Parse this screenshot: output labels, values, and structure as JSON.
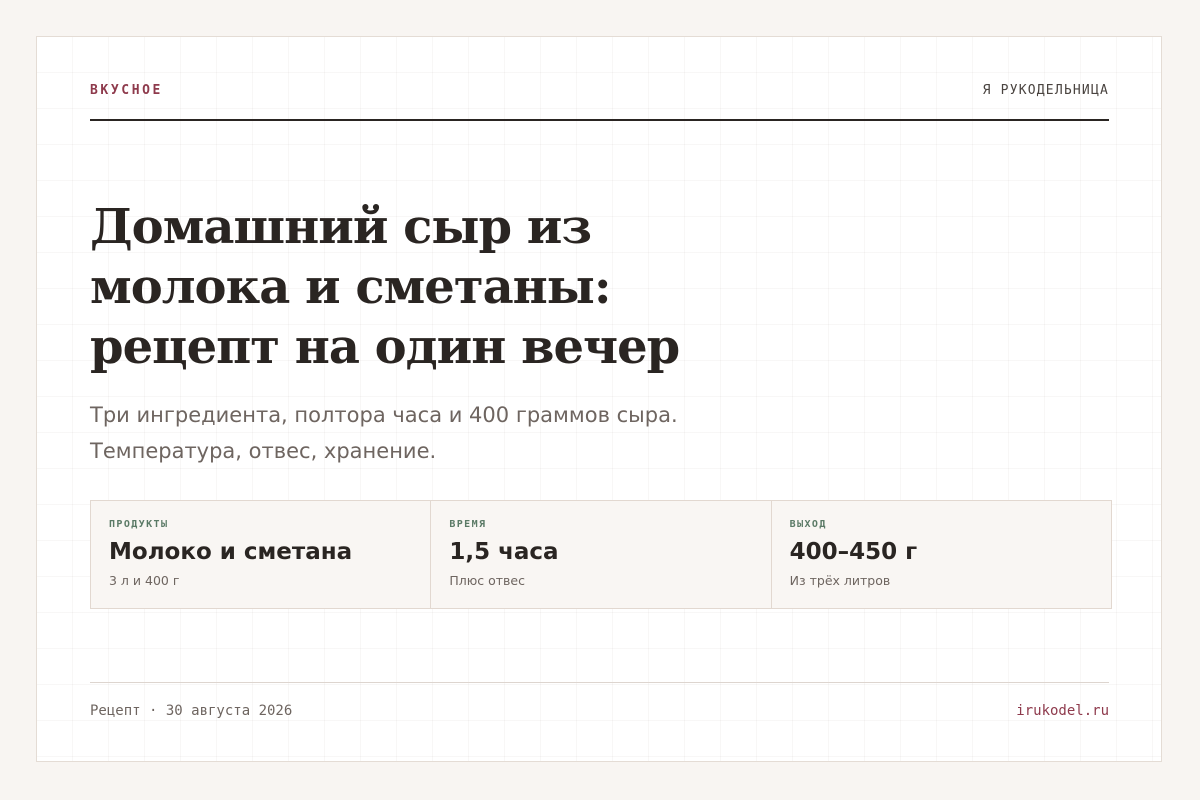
{
  "header": {
    "brand": "ВКУСНОЕ",
    "site_name": "Я РУКОДЕЛЬНИЦА"
  },
  "article": {
    "title": "Домашний сыр из молока и сметаны: рецепт на один вечер",
    "subtitle_lines": [
      "Три ингредиента, полтора часа и 400 граммов сыра.",
      "Температура, отвес, хранение."
    ]
  },
  "stats": [
    {
      "label": "ПРОДУКТЫ",
      "value": "Молоко и сметана",
      "note": "3 л и 400 г"
    },
    {
      "label": "ВРЕМЯ",
      "value": "1,5 часа",
      "note": "Плюс отвес"
    },
    {
      "label": "ВЫХОД",
      "value": "400–450 г",
      "note": "Из трёх литров"
    }
  ],
  "footer": {
    "meta": "Рецепт · 30 августа 2026",
    "domain": "irukodel.ru"
  },
  "colors": {
    "accent": "#8e3a4c",
    "label_green": "#5b7a66",
    "ink": "#2a2522",
    "muted": "#6e6560",
    "page_bg": "#f8f5f2",
    "card_bg": "#ffffff",
    "stats_bg": "#f9f6f3"
  }
}
